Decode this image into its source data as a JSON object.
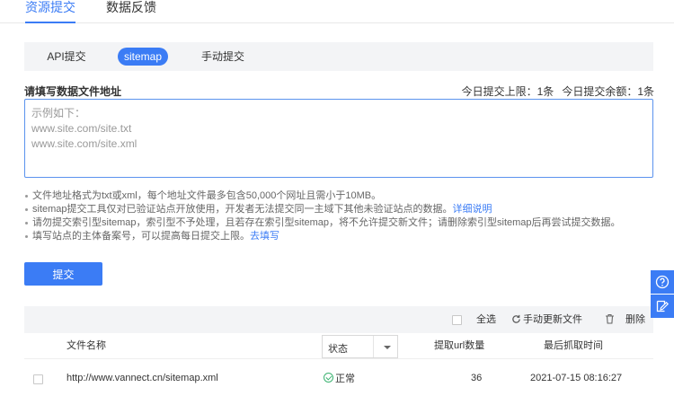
{
  "top_tabs": [
    {
      "label": "资源提交",
      "active": true
    },
    {
      "label": "数据反馈",
      "active": false
    }
  ],
  "sub_tabs": [
    {
      "label": "API提交",
      "active": false
    },
    {
      "label": "sitemap",
      "active": true
    },
    {
      "label": "手动提交",
      "active": false
    }
  ],
  "form": {
    "label": "请填写数据文件地址",
    "quota_limit": "今日提交上限：1条",
    "quota_remaining": "今日提交余额：1条",
    "placeholder": "示例如下：\nwww.site.com/site.txt\nwww.site.com/site.xml",
    "value": ""
  },
  "notes": [
    {
      "text": "文件地址格式为txt或xml，每个地址文件最多包含50,000个网址且需小于10MB。",
      "link": ""
    },
    {
      "text": "sitemap提交工具仅对已验证站点开放使用，开发者无法提交同一主域下其他未验证站点的数据。",
      "link": "详细说明"
    },
    {
      "text": "请勿提交索引型sitemap，索引型不予处理，且若存在索引型sitemap，将不允许提交新文件；请删除索引型sitemap后再尝试提交数据。",
      "link": ""
    },
    {
      "text": "填写站点的主体备案号，可以提高每日提交上限。",
      "link": "去填写"
    }
  ],
  "submit_label": "提交",
  "toolbar": {
    "select_all": "全选",
    "refresh": "手动更新文件",
    "delete": "删除"
  },
  "table": {
    "headers": {
      "file_name": "文件名称",
      "status": "状态",
      "url_count": "提取url数量",
      "last_crawl": "最后抓取时间"
    },
    "rows": [
      {
        "file_name": "http://www.vannect.cn/sitemap.xml",
        "status": "正常",
        "url_count": "36",
        "last_crawl": "2021-07-15 08:16:27"
      }
    ]
  },
  "colors": {
    "accent": "#3b7cf5",
    "success": "#3cb371",
    "panel_bg": "#f3f4f6"
  },
  "icons": {
    "refresh": "refresh-icon",
    "delete": "trash-icon",
    "help": "help-icon",
    "feedback": "feedback-icon",
    "status_ok": "check-circle-icon"
  }
}
